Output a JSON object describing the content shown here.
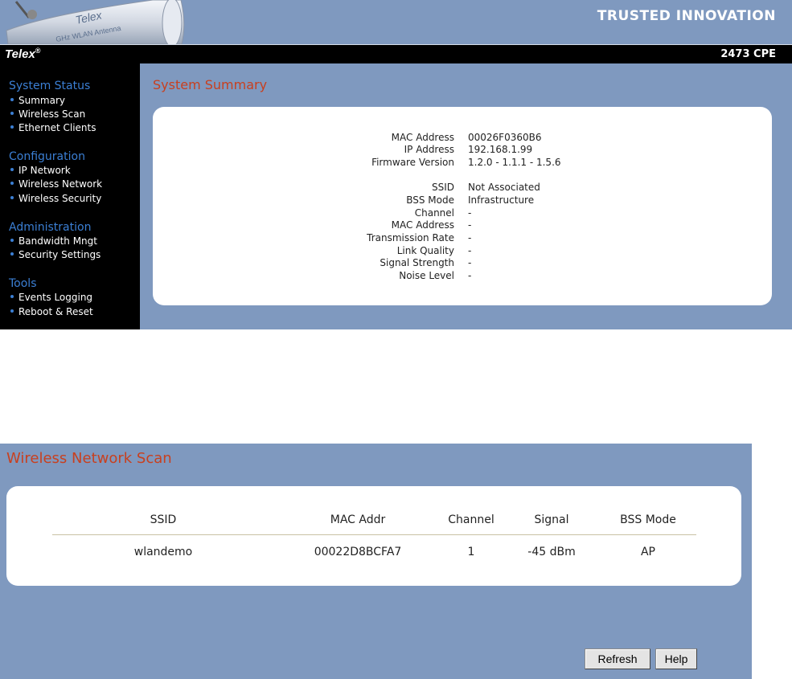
{
  "header": {
    "tagline": "TRUSTED INNOVATION",
    "brand": "Telex",
    "brand_mark": "®",
    "model": "2473 CPE",
    "antenna_label_brand": "Telex",
    "antenna_label_text": "GHz WLAN Antenna"
  },
  "sidebar": {
    "sections": [
      {
        "title": "System Status",
        "items": [
          "Summary",
          "Wireless Scan",
          "Ethernet Clients"
        ]
      },
      {
        "title": "Configuration",
        "items": [
          "IP Network",
          "Wireless Network",
          "Wireless Security"
        ]
      },
      {
        "title": "Administration",
        "items": [
          "Bandwidth Mngt",
          "Security Settings"
        ]
      },
      {
        "title": "Tools",
        "items": [
          "Events Logging",
          "Reboot & Reset"
        ]
      }
    ]
  },
  "summary": {
    "title": "System Summary",
    "rows": [
      {
        "label": "MAC Address",
        "value": "00026F0360B6"
      },
      {
        "label": "IP Address",
        "value": "192.168.1.99"
      },
      {
        "label": "Firmware Version",
        "value": "1.2.0 - 1.1.1 - 1.5.6"
      },
      {
        "label": "SSID",
        "value": "Not Associated"
      },
      {
        "label": "BSS Mode",
        "value": "Infrastructure"
      },
      {
        "label": "Channel",
        "value": "-"
      },
      {
        "label": "MAC Address",
        "value": "-"
      },
      {
        "label": "Transmission Rate",
        "value": "-"
      },
      {
        "label": "Link Quality",
        "value": "-"
      },
      {
        "label": "Signal Strength",
        "value": "-"
      },
      {
        "label": "Noise Level",
        "value": "-"
      }
    ]
  },
  "scan": {
    "title": "Wireless Network Scan",
    "columns": [
      "SSID",
      "MAC Addr",
      "Channel",
      "Signal",
      "BSS Mode"
    ],
    "rows": [
      [
        "wlandemo",
        "00022D8BCFA7",
        "1",
        "-45 dBm",
        "AP"
      ]
    ],
    "buttons": {
      "refresh": "Refresh",
      "help": "Help"
    }
  },
  "colors": {
    "panel_bg": "#7f99bf",
    "sidebar_bg": "#000000",
    "section_heading": "#3b7fd4",
    "page_title": "#c8401f"
  }
}
